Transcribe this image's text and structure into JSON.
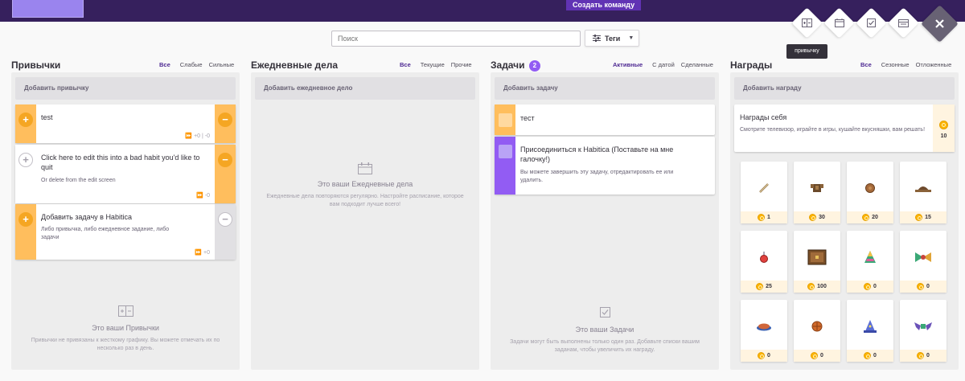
{
  "header": {
    "create_team_label": "Создать команду"
  },
  "search": {
    "placeholder": "Поиск"
  },
  "tags": {
    "label": "Теги"
  },
  "tooltip": "привычку",
  "habits": {
    "title": "Привычки",
    "filters": [
      "Все",
      "Слабые",
      "Сильные"
    ],
    "add_label": "Добавить привычку",
    "items": [
      {
        "title": "test",
        "notes": "",
        "meta": "⏩ +0 | -0"
      },
      {
        "title": "Click here to edit this into a bad habit you'd like to quit",
        "notes": "Or delete from the edit screen",
        "meta": "⏩ -0"
      },
      {
        "title": "Добавить задачу в Habitica",
        "notes": "Либо привычка, либо ежедневное задание, либо задачи",
        "meta": "⏩ +0"
      }
    ],
    "empty_title": "Это ваши Привычки",
    "empty_text": "Привычки не привязаны к жесткому графику. Вы можете отмечать их по несколько раз в день."
  },
  "dailies": {
    "title": "Ежедневные дела",
    "filters": [
      "Все",
      "Текущие",
      "Прочие"
    ],
    "add_label": "Добавить ежедневное дело",
    "empty_title": "Это ваши Ежедневные дела",
    "empty_text": "Ежедневные дела повторяются регулярно. Настройте расписание, которое вам подходит лучше всего!"
  },
  "todos": {
    "title": "Задачи",
    "badge": "2",
    "filters": [
      "Активные",
      "С датой",
      "Сделанные"
    ],
    "add_label": "Добавить задачу",
    "items": [
      {
        "title": "тест",
        "notes": ""
      },
      {
        "title": "Присоединиться к Habitica (Поставьте на мне галочку!)",
        "notes": "Вы можете завершить эту задачу, отредактировать ее или удалить."
      }
    ],
    "empty_title": "Это ваши Задачи",
    "empty_text": "Задачи могут быть выполнены только один раз. Добавьте списки вашим заданам, чтобы увеличить их награду."
  },
  "rewards": {
    "title": "Награды",
    "filters": [
      "Все",
      "Сезонные",
      "Отложенные"
    ],
    "add_label": "Добавить награду",
    "custom": {
      "title": "Награды себя",
      "notes": "Смотрите телевизор, играйте в игры, кушайте вкусняшки, вам решать!",
      "price": "10"
    },
    "shop_items": [
      {
        "price": "1",
        "icon": "potion-stick-icon"
      },
      {
        "price": "30",
        "icon": "armor-icon"
      },
      {
        "price": "20",
        "icon": "shield-icon"
      },
      {
        "price": "15",
        "icon": "helmet-icon"
      },
      {
        "price": "25",
        "icon": "health-potion-icon"
      },
      {
        "price": "100",
        "icon": "chest-icon"
      },
      {
        "price": "0",
        "icon": "party-hat-icon"
      },
      {
        "price": "0",
        "icon": "winged-item-icon"
      },
      {
        "price": "0",
        "icon": "pie-icon"
      },
      {
        "price": "0",
        "icon": "round-shield-icon"
      },
      {
        "price": "0",
        "icon": "wizard-hat-icon"
      },
      {
        "price": "0",
        "icon": "bat-wings-icon"
      }
    ]
  }
}
